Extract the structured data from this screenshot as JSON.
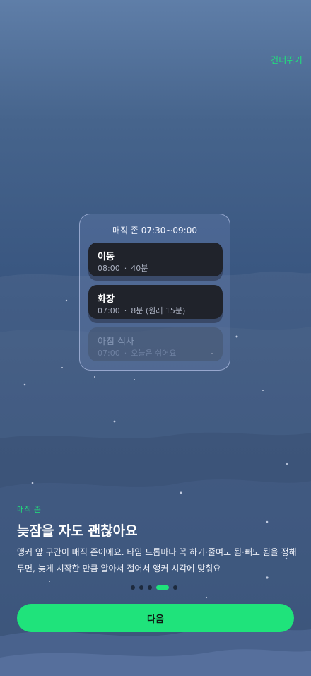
{
  "header": {
    "skip_label": "건너뛰기"
  },
  "card": {
    "title": "매직 존 07:30~09:00",
    "tasks": [
      {
        "name": "이동",
        "time": "08:00",
        "sep": "·",
        "detail": "40분"
      },
      {
        "name": "화장",
        "time": "07:00",
        "sep": "·",
        "detail": "8분 (원래 15분)"
      },
      {
        "name": "아침 식사",
        "time": "07:00",
        "sep": "·",
        "detail": "오늘은 쉬어요"
      }
    ]
  },
  "content": {
    "tag": "매직 존",
    "headline": "늦잠을 자도 괜찮아요",
    "description": "앵커 앞 구간이 매직 존이에요. 타임 드롭마다 꼭 하기·줄여도 됨·빼도 됨을 정해 두면, 늦게 시작한 만큼 알아서 접어서 앵커 시각에 맞춰요"
  },
  "pager": {
    "count": 5,
    "active_index": 3
  },
  "footer": {
    "next_label": "다음"
  },
  "colors": {
    "accent": "#1fe37b",
    "task_bg": "#20232b"
  },
  "icons": [
    "sparkle-dots"
  ]
}
